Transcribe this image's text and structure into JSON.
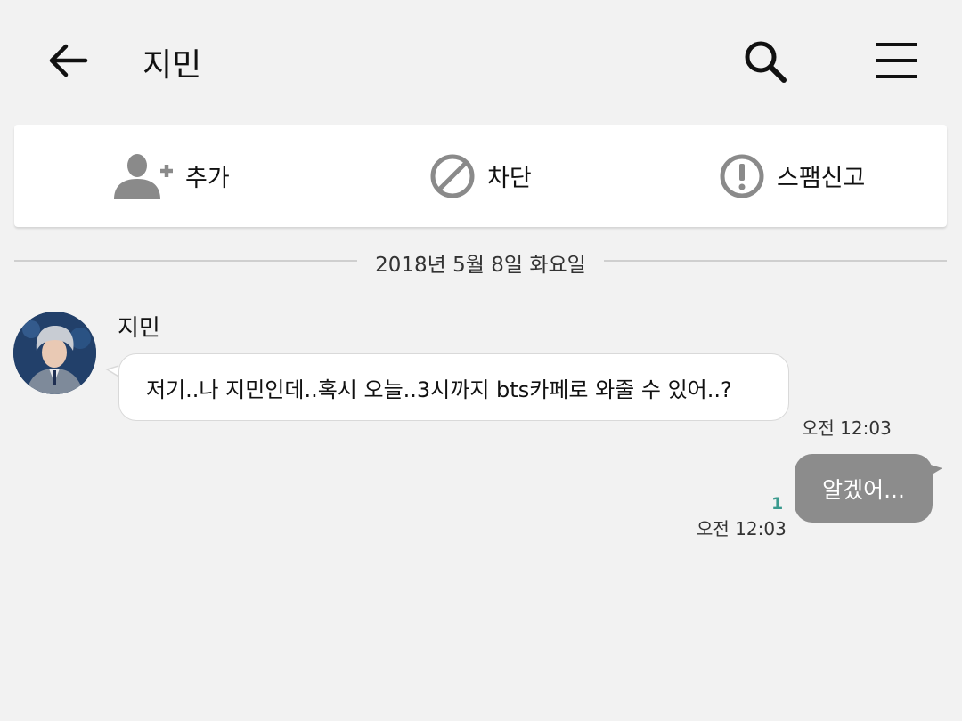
{
  "header": {
    "back_icon": "arrow-left-icon",
    "title": "지민",
    "search_icon": "search-icon",
    "menu_icon": "hamburger-menu-icon"
  },
  "actions": {
    "add_label": "추가",
    "add_icon": "add-person-icon",
    "block_label": "차단",
    "block_icon": "block-icon",
    "spam_label": "스팸신고",
    "spam_icon": "alert-circle-icon"
  },
  "date_separator": "2018년 5월 8일 화요일",
  "messages": [
    {
      "direction": "incoming",
      "sender": "지민",
      "text": "저기..나 지민인데..혹시 오늘..3시까지 bts카페로 와줄 수 있어..?",
      "time": "오전 12:03"
    },
    {
      "direction": "outgoing",
      "text": "알겠어...",
      "unread_count": "1",
      "time": "오전 12:03"
    }
  ],
  "colors": {
    "background": "#f2f2f2",
    "outgoing_bubble": "#8c8c8c",
    "incoming_bubble": "#ffffff",
    "unread_count": "#3a9a8e",
    "action_icon": "#8a8a8a"
  }
}
